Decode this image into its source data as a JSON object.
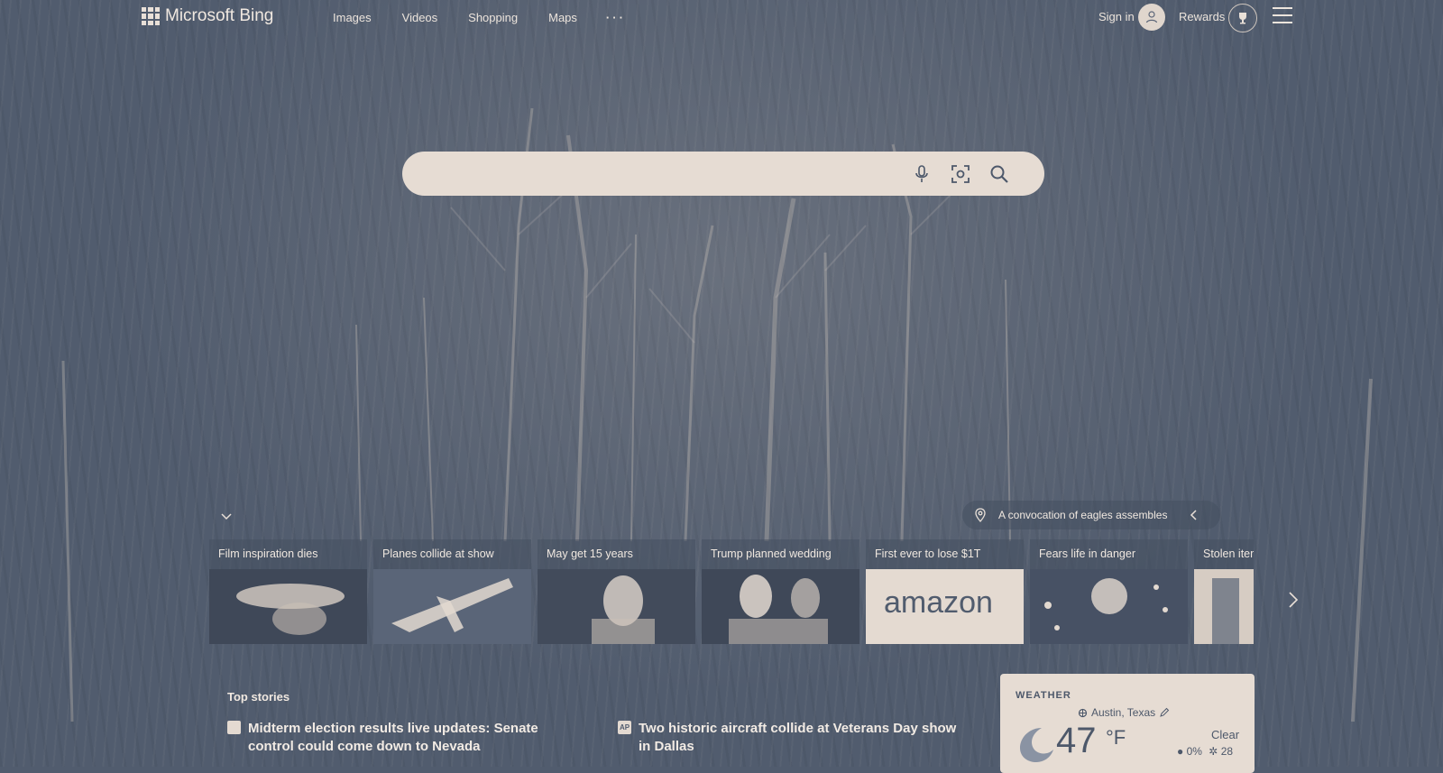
{
  "header": {
    "logo_text": "Microsoft Bing",
    "nav": [
      "Images",
      "Videos",
      "Shopping",
      "Maps",
      "···"
    ],
    "sign_in": "Sign in",
    "rewards": "Rewards"
  },
  "search": {
    "placeholder": "",
    "icons": [
      "microphone-icon",
      "visual-search-icon",
      "search-icon"
    ]
  },
  "caption": {
    "text": "A convocation of eagles assembles"
  },
  "news_cards": [
    {
      "title": "Film inspiration dies"
    },
    {
      "title": "Planes collide at show"
    },
    {
      "title": "May get 15 years"
    },
    {
      "title": "Trump planned wedding"
    },
    {
      "title": "First ever to lose $1T",
      "thumb_text": "amazon"
    },
    {
      "title": "Fears life in danger"
    },
    {
      "title": "Stolen item"
    }
  ],
  "top_stories": {
    "label": "Top stories",
    "items": [
      {
        "source_badge": "",
        "headline": "Midterm election results live updates: Senate control could come down to Nevada"
      },
      {
        "source_badge": "AP",
        "headline": "Two historic aircraft collide at Veterans Day show in Dallas"
      }
    ]
  },
  "weather": {
    "label": "WEATHER",
    "location": "Austin, Texas",
    "temp": "47",
    "unit": "°F",
    "condition": "Clear",
    "precip": "0%",
    "aqi": "28"
  },
  "colors": {
    "background": "#515c6e",
    "surface": "#e6dcd3",
    "text_light": "#ece4dc"
  }
}
